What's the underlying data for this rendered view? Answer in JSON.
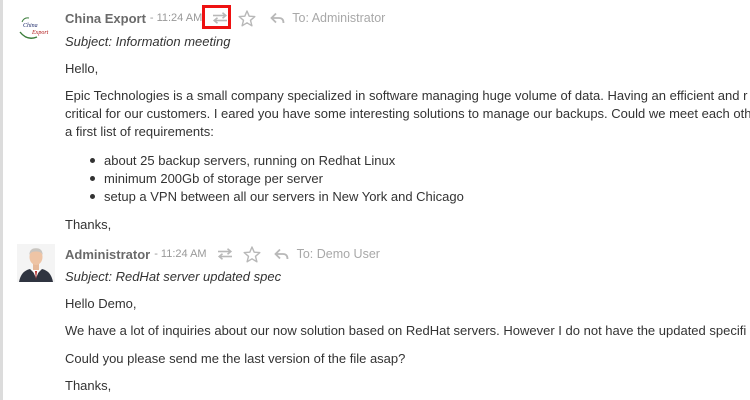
{
  "messages": [
    {
      "author": "China Export",
      "separator": "-",
      "time": "11:24 AM",
      "recipient": "To: Administrator",
      "avatar_logo_text": [
        "China",
        "Export"
      ],
      "subject": "Subject: Information meeting",
      "greeting": "Hello,",
      "paragraph_lines": [
        "Epic Technologies is a small company specialized in software managing huge volume of data. Having an efficient and r",
        "critical for our customers. I eared you have some interesting solutions to manage our backups. Could we meet each oth",
        "a first list of requirements:"
      ],
      "bullets": [
        "about 25 backup servers, running on Redhat Linux",
        "minimum 200Gb of storage per server",
        "setup a VPN between all our servers in New York and Chicago"
      ],
      "closing": "Thanks,"
    },
    {
      "author": "Administrator",
      "separator": "-",
      "time": "11:24 AM",
      "recipient": "To: Demo User",
      "subject": "Subject: RedHat server updated spec",
      "greeting": "Hello Demo,",
      "paragraph_lines": [
        "We have a lot of inquiries about our now solution based on RedHat servers. However I do not have the updated specifi"
      ],
      "question": "Could you please send me the last version of the file asap?",
      "closing": "Thanks,"
    }
  ],
  "icons": {
    "swap": "swap-arrows-icon",
    "star": "star-icon",
    "reply": "reply-icon"
  },
  "colors": {
    "highlight_border": "#ee1111",
    "author": "#6a6a6a",
    "meta": "#999999",
    "icon": "#b8b8b8"
  }
}
